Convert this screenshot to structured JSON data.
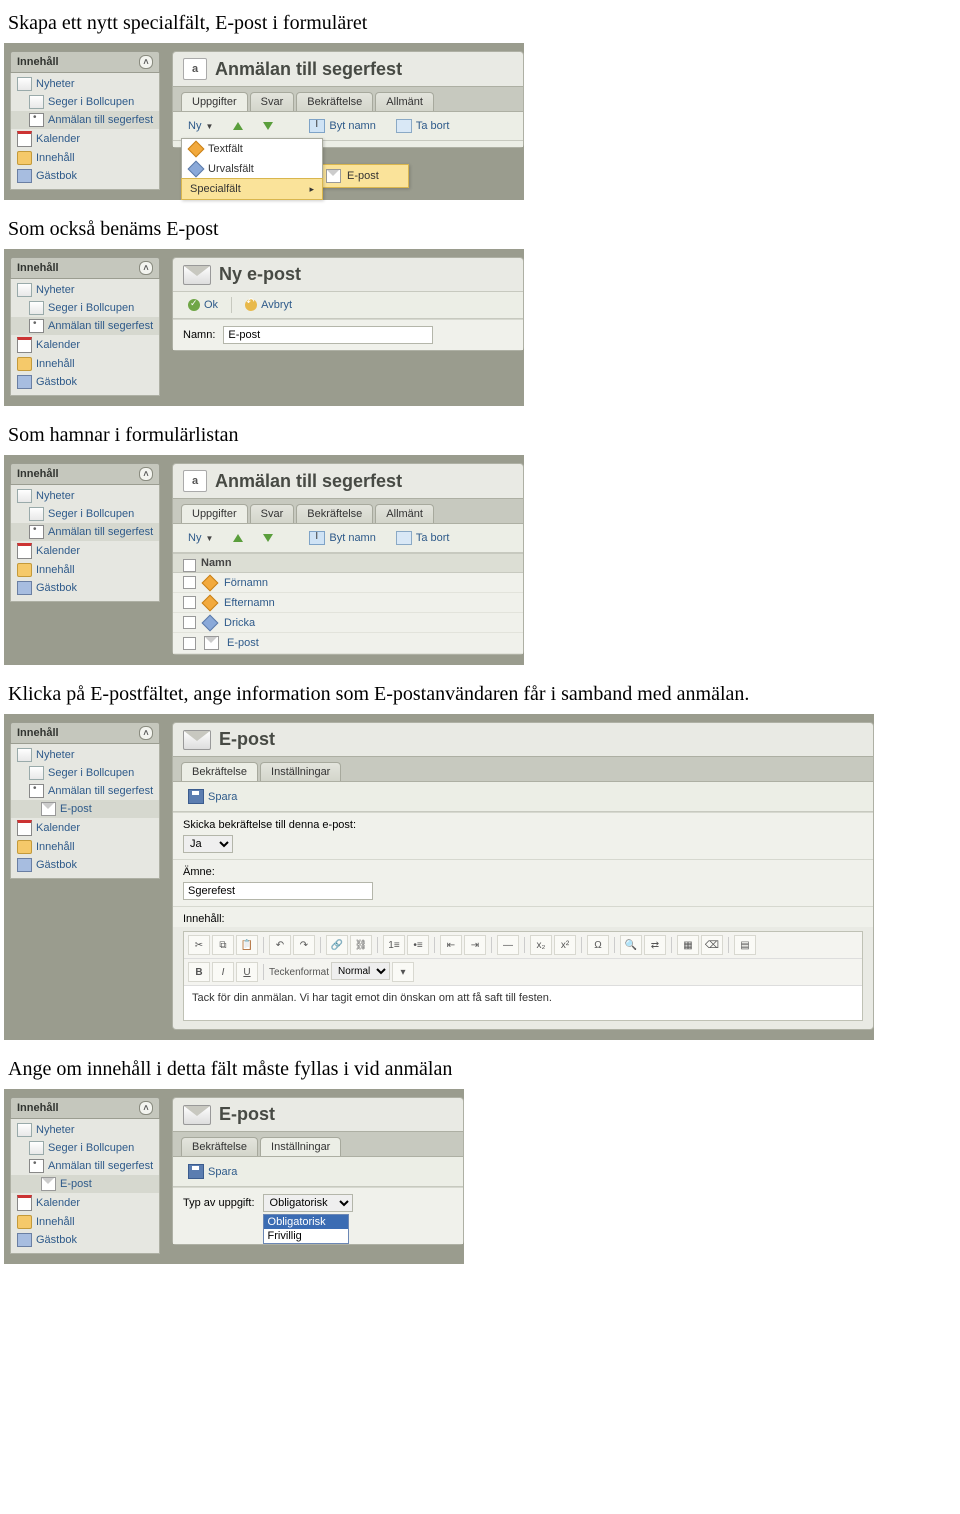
{
  "doc": {
    "t1": "Skapa ett nytt specialfält, E-post i formuläret",
    "t2": "Som också benäms E-post",
    "t3": "Som hamnar i formulärlistan",
    "t4": "Klicka på E-postfältet, ange information som E-postanvändaren får i samband med anmälan.",
    "t5": "Ange om innehåll i detta fält måste fyllas i vid anmälan"
  },
  "sidebar": {
    "header": "Innehåll",
    "items": [
      {
        "label": "Nyheter",
        "icon": "doc"
      },
      {
        "label": "Seger i Bollcupen",
        "icon": "doc",
        "indent": 1
      },
      {
        "label": "Anmälan till segerfest",
        "icon": "box",
        "indent": 1,
        "active": true
      },
      {
        "label": "Kalender",
        "icon": "cal"
      },
      {
        "label": "Innehåll",
        "icon": "folder"
      },
      {
        "label": "Gästbok",
        "icon": "book"
      }
    ],
    "items_epost": [
      {
        "label": "Nyheter",
        "icon": "doc"
      },
      {
        "label": "Seger i Bollcupen",
        "icon": "doc",
        "indent": 1
      },
      {
        "label": "Anmälan till segerfest",
        "icon": "box",
        "indent": 1
      },
      {
        "label": "E-post",
        "icon": "env",
        "indent": 2,
        "active": true
      },
      {
        "label": "Kalender",
        "icon": "cal"
      },
      {
        "label": "Innehåll",
        "icon": "folder"
      },
      {
        "label": "Gästbok",
        "icon": "book"
      }
    ]
  },
  "form": {
    "title": "Anmälan till segerfest",
    "title_letter": "a",
    "tabs": [
      "Uppgifter",
      "Svar",
      "Bekräftelse",
      "Allmänt"
    ],
    "toolbar": {
      "ny": "Ny",
      "byt": "Byt namn",
      "ta": "Ta bort"
    },
    "dd": {
      "textfalt": "Textfält",
      "urvalsfalt": "Urvalsfält",
      "specialfalt": "Specialfält",
      "epost": "E-post"
    },
    "list_head": "Namn",
    "rows": [
      "Förnamn",
      "Efternamn",
      "Dricka",
      "E-post"
    ],
    "row_icons": [
      "o",
      "o",
      "b",
      "env"
    ]
  },
  "nyepost": {
    "title": "Ny e-post",
    "ok": "Ok",
    "avbryt": "Avbryt",
    "namn_label": "Namn:",
    "namn_value": "E-post"
  },
  "epost": {
    "title": "E-post",
    "tabs": [
      "Bekräftelse",
      "Inställningar"
    ],
    "spara": "Spara",
    "skicka_label": "Skicka bekräftelse till denna e-post:",
    "skicka_value": "Ja",
    "amne_label": "Ämne:",
    "amne_value": "Sgerefest",
    "innehall_label": "Innehåll:",
    "rte_format_label": "Teckenformat",
    "rte_format_value": "Normal",
    "rte_text": "Tack för din anmälan. Vi har tagit emot din önskan om att få saft till festen.",
    "typ_label": "Typ av uppgift:",
    "typ_value": "Obligatorisk",
    "typ_options": [
      "Obligatorisk",
      "Frivillig"
    ]
  }
}
